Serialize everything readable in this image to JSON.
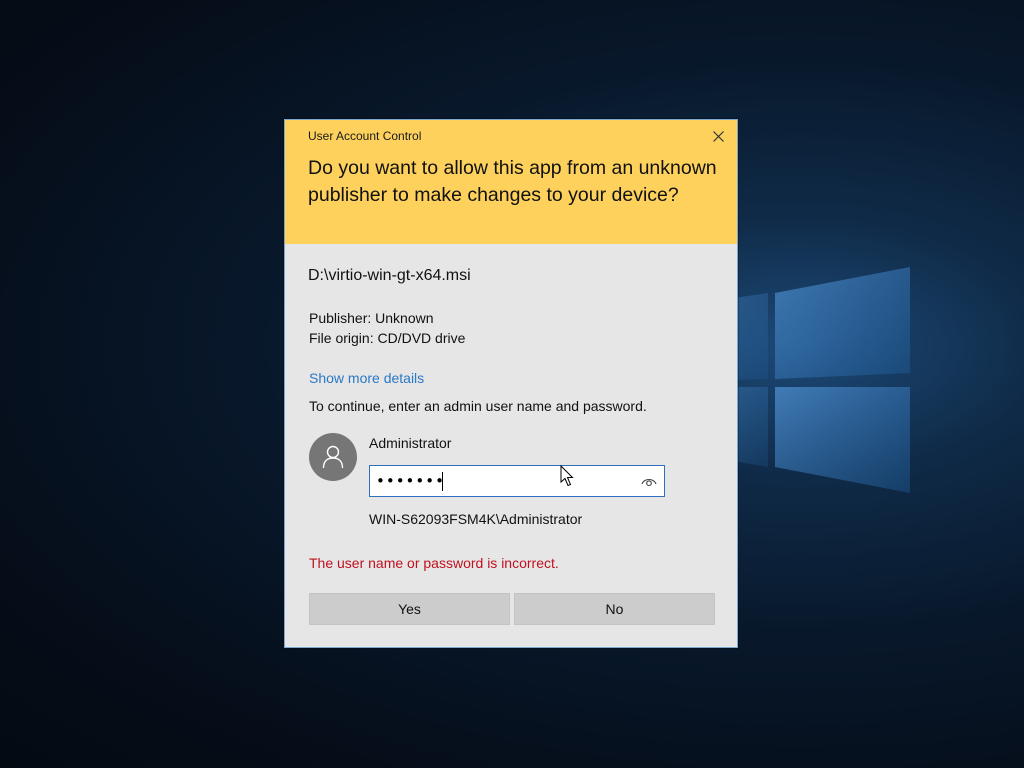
{
  "dialog": {
    "title": "User Account Control",
    "question": "Do you want to allow this app from an unknown publisher to make changes to your device?",
    "filename": "D:\\virtio-win-gt-x64.msi",
    "publisher": "Publisher: Unknown",
    "file_origin": "File origin: CD/DVD drive",
    "show_details_label": "Show more details",
    "continue_prompt": "To continue, enter an admin user name and password.",
    "account": {
      "username": "Administrator",
      "password_value": "•••••••",
      "domain_user": "WIN-S62093FSM4K\\Administrator"
    },
    "error_message": "The user name or password is incorrect.",
    "yes_label": "Yes",
    "no_label": "No"
  },
  "icons": {
    "close": "close-icon",
    "avatar": "user-icon",
    "reveal": "eye-icon"
  },
  "colors": {
    "header_bg": "#fdd15c",
    "body_bg": "#e6e6e6",
    "link": "#2b78c5",
    "error": "#c0111f",
    "button": "#cccccc"
  }
}
